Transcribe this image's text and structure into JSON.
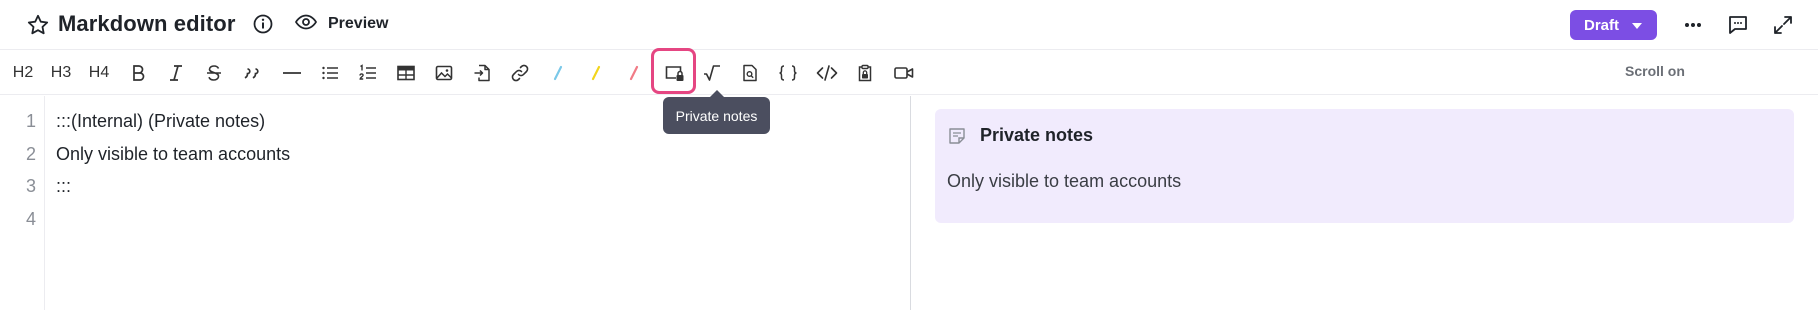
{
  "header": {
    "title": "Markdown editor",
    "preview_label": "Preview",
    "draft_label": "Draft",
    "icons": [
      "star-icon",
      "info-icon",
      "eye-icon",
      "chevron-down-icon",
      "more-icon",
      "comment-icon",
      "expand-icon"
    ]
  },
  "toolbar": {
    "h2": "H2",
    "h3": "H3",
    "h4": "H4",
    "scroll_label": "Scroll on",
    "tooltip": "Private notes",
    "colors": {
      "blue_marker": "#7ac8e8",
      "yellow_marker": "#f2d51c",
      "red_marker": "#f17b86",
      "highlight_border": "#e54682"
    }
  },
  "editor": {
    "line_numbers": [
      "1",
      "2",
      "3",
      "4"
    ],
    "lines": [
      ":::(Internal) (Private notes)",
      "Only visible to team accounts",
      ":::",
      ""
    ]
  },
  "preview": {
    "note_title": "Private notes",
    "note_body": "Only visible to team accounts"
  },
  "colors": {
    "accent": "#7c4ee4",
    "note_bg": "#f1ebfd",
    "tooltip_bg": "#4b4e5f"
  }
}
